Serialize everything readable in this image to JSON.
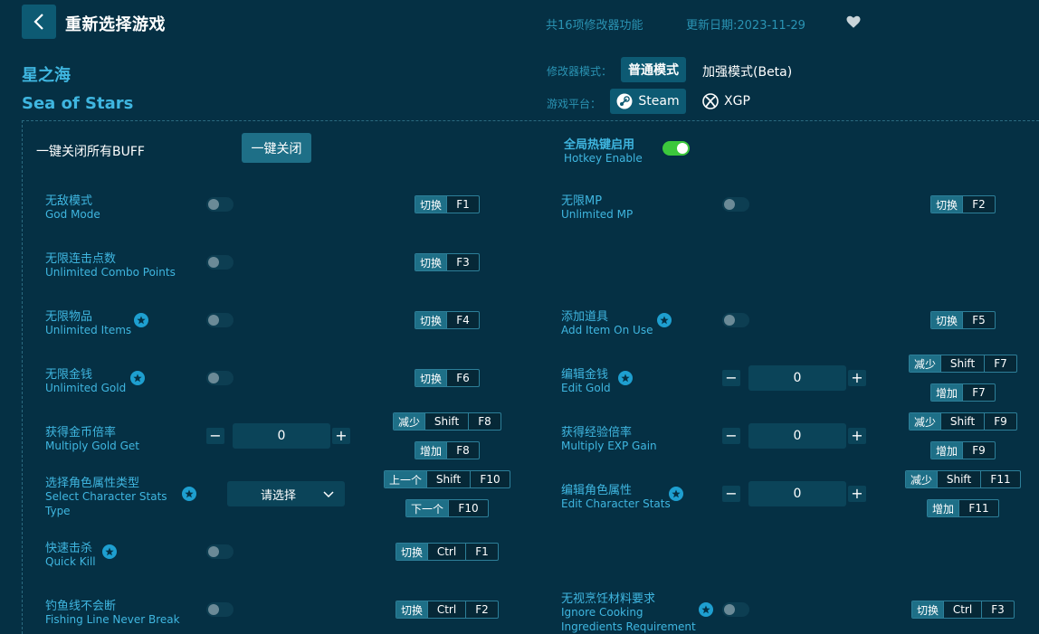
{
  "header": {
    "title": "重新选择游戏",
    "feature_count": "共16项修改器功能",
    "update_date": "更新日期:2023-11-29"
  },
  "game": {
    "name_cn": "星之海",
    "name_en": "Sea of Stars"
  },
  "mode": {
    "label": "修改器模式：",
    "normal": "普通模式",
    "beta": "加强模式(Beta)"
  },
  "platform": {
    "label": "游戏平台：",
    "steam": "Steam",
    "xgp": "XGP"
  },
  "top": {
    "close_all_label": "一键关闭所有BUFF",
    "close_all_button": "一键关闭",
    "hotkey_cn": "全局热键启用",
    "hotkey_en": "Hotkey Enable"
  },
  "features": {
    "god_mode": {
      "cn": "无敌模式",
      "en": "God Mode",
      "act": "切换",
      "key": "F1"
    },
    "unlimited_mp": {
      "cn": "无限MP",
      "en": "Unlimited MP",
      "act": "切换",
      "key": "F2"
    },
    "combo": {
      "cn": "无限连击点数",
      "en": "Unlimited Combo Points",
      "act": "切换",
      "key": "F3"
    },
    "items": {
      "cn": "无限物品",
      "en": "Unlimited Items",
      "act": "切换",
      "key": "F4"
    },
    "add_item": {
      "cn": "添加道具",
      "en": "Add Item On Use",
      "act": "切换",
      "key": "F5"
    },
    "gold": {
      "cn": "无限金钱",
      "en": "Unlimited Gold",
      "act": "切换",
      "key": "F6"
    },
    "edit_gold": {
      "cn": "编辑金钱",
      "en": "Edit Gold",
      "value": "0",
      "dec": "减少",
      "inc": "增加",
      "mod": "Shift",
      "key": "F7"
    },
    "gold_mult": {
      "cn": "获得金币倍率",
      "en": "Multiply Gold Get",
      "value": "0",
      "dec": "减少",
      "inc": "增加",
      "mod": "Shift",
      "key": "F8"
    },
    "exp_mult": {
      "cn": "获得经验倍率",
      "en": "Multiply EXP Gain",
      "value": "0",
      "dec": "减少",
      "inc": "增加",
      "mod": "Shift",
      "key": "F9"
    },
    "stats_type": {
      "cn": "选择角色属性类型",
      "en1": "Select Character Stats",
      "en2": "Type",
      "placeholder": "请选择",
      "prev": "上一个",
      "next": "下一个",
      "mod": "Shift",
      "key": "F10"
    },
    "edit_stats": {
      "cn": "编辑角色属性",
      "en": "Edit Character Stats",
      "value": "0",
      "dec": "减少",
      "inc": "增加",
      "mod": "Shift",
      "key": "F11"
    },
    "quick_kill": {
      "cn": "快速击杀",
      "en": "Quick Kill",
      "act": "切换",
      "mod": "Ctrl",
      "key": "F1"
    },
    "fishing": {
      "cn": "钓鱼线不会断",
      "en": "Fishing Line Never Break",
      "act": "切换",
      "mod": "Ctrl",
      "key": "F2"
    },
    "cooking": {
      "cn": "无视烹饪材料要求",
      "en1": "Ignore Cooking",
      "en2": "Ingredients Requirement",
      "act": "切换",
      "mod": "Ctrl",
      "key": "F3"
    }
  }
}
